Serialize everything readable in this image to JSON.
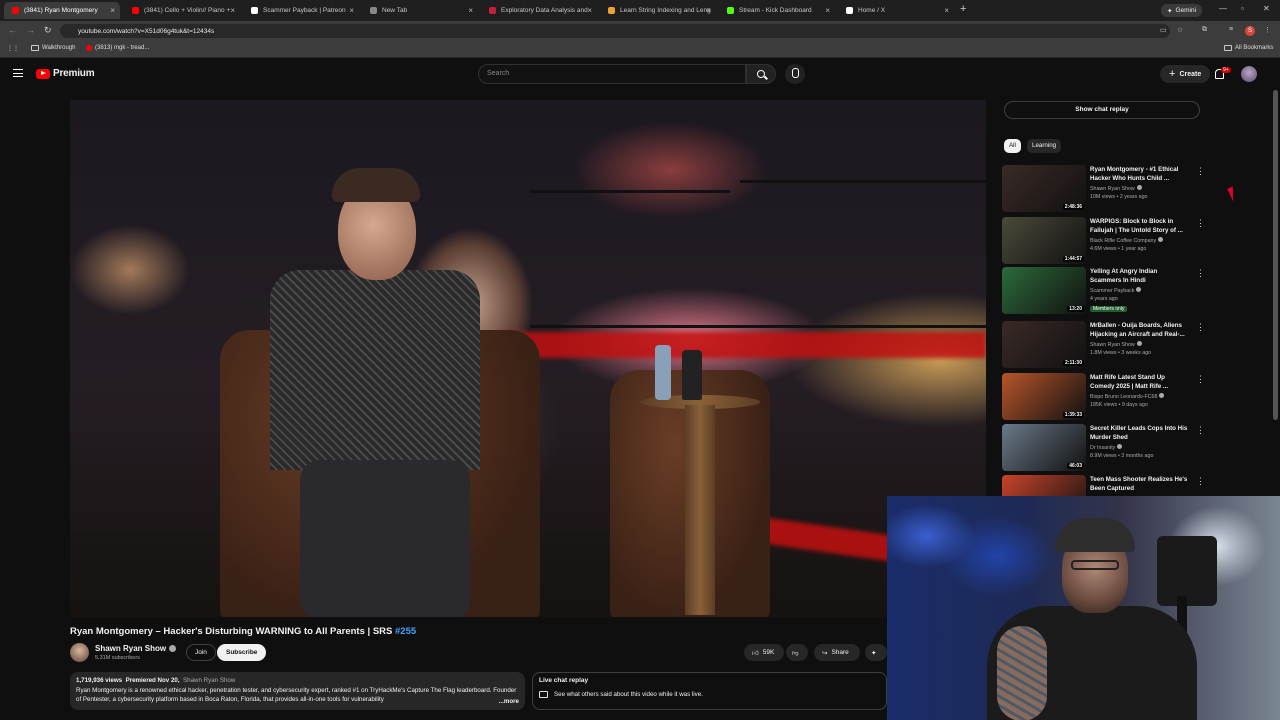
{
  "browser": {
    "tabs": [
      {
        "title": "(3841) Ryan Montgomery",
        "fav": "#ff0000",
        "active": true
      },
      {
        "title": "(3841) Cello + Violin// Piano +",
        "fav": "#ff0000",
        "active": false
      },
      {
        "title": "Scammer Payback | Patreon",
        "fav": "#ffffff",
        "active": false
      },
      {
        "title": "New Tab",
        "fav": "#888888",
        "active": false
      },
      {
        "title": "Exploratory Data Analysis and",
        "fav": "#c41e3a",
        "active": false
      },
      {
        "title": "Learn String Indexing and Leng",
        "fav": "#f0a030",
        "active": false
      },
      {
        "title": "Stream - Kick Dashboard",
        "fav": "#53fc18",
        "active": false
      },
      {
        "title": "Home / X",
        "fav": "#ffffff",
        "active": false
      }
    ],
    "gemini_label": "Gemini",
    "url": "youtube.com/watch?v=X51d06g4tuk&t=12434s",
    "profile_initial": "S",
    "bookmarks": [
      {
        "label": "Walkthrough"
      },
      {
        "label": "(3813) mgk - tread..."
      }
    ],
    "all_bookmarks": "All Bookmarks"
  },
  "youtube": {
    "logo_text": "Premium",
    "search_placeholder": "Search",
    "create_label": "Create",
    "notification_badge": "9+"
  },
  "video": {
    "title_main": "Ryan Montgomery – Hacker's Disturbing WARNING to All Parents | SRS ",
    "title_tag": "#255",
    "channel": "Shawn Ryan Show",
    "subscribers": "5.31M subscribers",
    "join_label": "Join",
    "subscribe_label": "Subscribe",
    "likes": "59K",
    "share_label": "Share",
    "description": {
      "views": "1,719,936 views",
      "premiered": "Premiered Nov 20,",
      "channel_link": "Shawn Ryan Show",
      "text": "Ryan Montgomery is a renowned ethical hacker, penetration tester, and cybersecurity expert, ranked #1 on TryHackMe's Capture The Flag leaderboard. Founder of Pentester, a cybersecurity platform based in Boca Raton, Florida, that provides all-in-one tools for vulnerability",
      "more": "...more"
    },
    "live_chat": {
      "title": "Live chat replay",
      "subtitle": "See what others said about this video while it was live."
    }
  },
  "sidebar": {
    "show_chat_replay": "Show chat replay",
    "chips": [
      "All",
      "Learning"
    ],
    "recommendations": [
      {
        "title": "Ryan Montgomery - #1 Ethical Hacker Who Hunts Child ...",
        "channel": "Shawn Ryan Show",
        "meta": "10M views • 2 years ago",
        "duration": "2:48:36",
        "badge": "",
        "thumb": "#3a2a26"
      },
      {
        "title": "WARPIGS: Block to Block in Fallujah | The Untold Story of ...",
        "channel": "Black Rifle Coffee Company",
        "meta": "4.6M views • 1 year ago",
        "duration": "1:44:57",
        "badge": "",
        "thumb": "#4a4a3a"
      },
      {
        "title": "Yelling At Angry Indian Scammers In Hindi",
        "channel": "Scammer Payback",
        "meta": "4 years ago",
        "duration": "13:20",
        "badge": "Members only",
        "thumb": "#2d6a3a"
      },
      {
        "title": "MrBallen - Ouija Boards, Aliens Hijacking an Aircraft and Real-...",
        "channel": "Shawn Ryan Show",
        "meta": "1.8M views • 3 weeks ago",
        "duration": "2:11:30",
        "badge": "",
        "thumb": "#3a2a26"
      },
      {
        "title": "Matt Rife Latest Stand Up Comedy 2025 | Matt Rife ...",
        "channel": "Bispo Bruno Leonardo-FC68",
        "meta": "185K views • 9 days ago",
        "duration": "1:39:33",
        "badge": "",
        "thumb": "#b8552a"
      },
      {
        "title": "Secret Killer Leads Cops Into His Murder Shed",
        "channel": "Dr Insanity",
        "meta": "8.9M views • 3 months ago",
        "duration": "46:03",
        "badge": "",
        "thumb": "#6a7a8a"
      },
      {
        "title": "Teen Mass Shooter Realizes He's Been Captured",
        "channel": "",
        "meta": "",
        "duration": "",
        "badge": "",
        "thumb": "#c8442a"
      }
    ]
  }
}
